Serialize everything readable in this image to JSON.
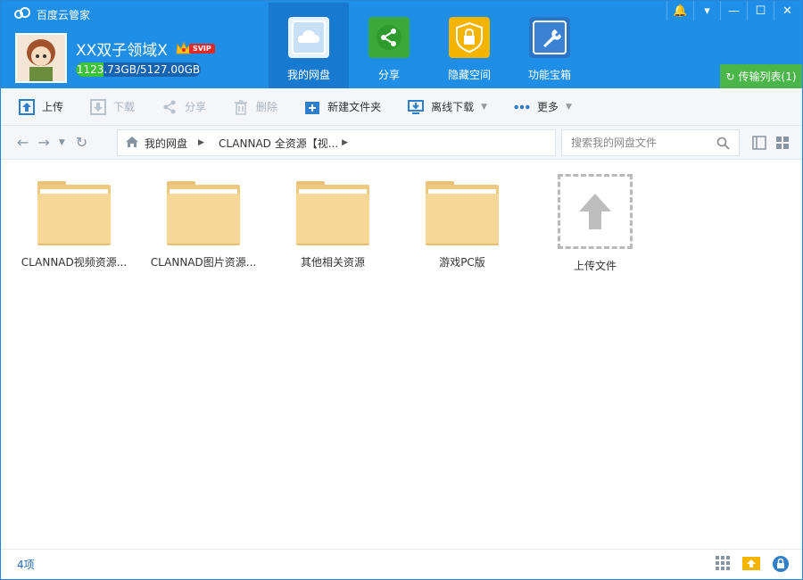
{
  "app": {
    "title": "百度云管家"
  },
  "user": {
    "name": "XX双子领域X",
    "badge": "SVIP",
    "quota_text": "1123.73GB/5127.00GB",
    "quota_used_fraction": 0.219
  },
  "nav": [
    {
      "label": "我的网盘",
      "icon": "cloud-icon",
      "active": true
    },
    {
      "label": "分享",
      "icon": "share-icon"
    },
    {
      "label": "隐藏空间",
      "icon": "lock-icon"
    },
    {
      "label": "功能宝箱",
      "icon": "wrench-icon"
    }
  ],
  "transfer_label": "传输列表(1)",
  "toolbar": {
    "upload": "上传",
    "download": "下载",
    "share": "分享",
    "delete": "删除",
    "new_folder": "新建文件夹",
    "offline_download": "离线下载",
    "more": "更多"
  },
  "breadcrumb": {
    "root": "我的网盘",
    "current": "CLANNAD 全资源【视..."
  },
  "search": {
    "placeholder": "搜索我的网盘文件"
  },
  "files": [
    {
      "name": "CLANNAD视频资源..."
    },
    {
      "name": "CLANNAD图片资源..."
    },
    {
      "name": "其他相关资源"
    },
    {
      "name": "游戏PC版"
    }
  ],
  "upload_tile": {
    "label": "上传文件"
  },
  "status": {
    "count": "4项"
  },
  "colors": {
    "header": "#1e8ee6",
    "transfer": "#4ab548",
    "folder": "#f6d797"
  }
}
